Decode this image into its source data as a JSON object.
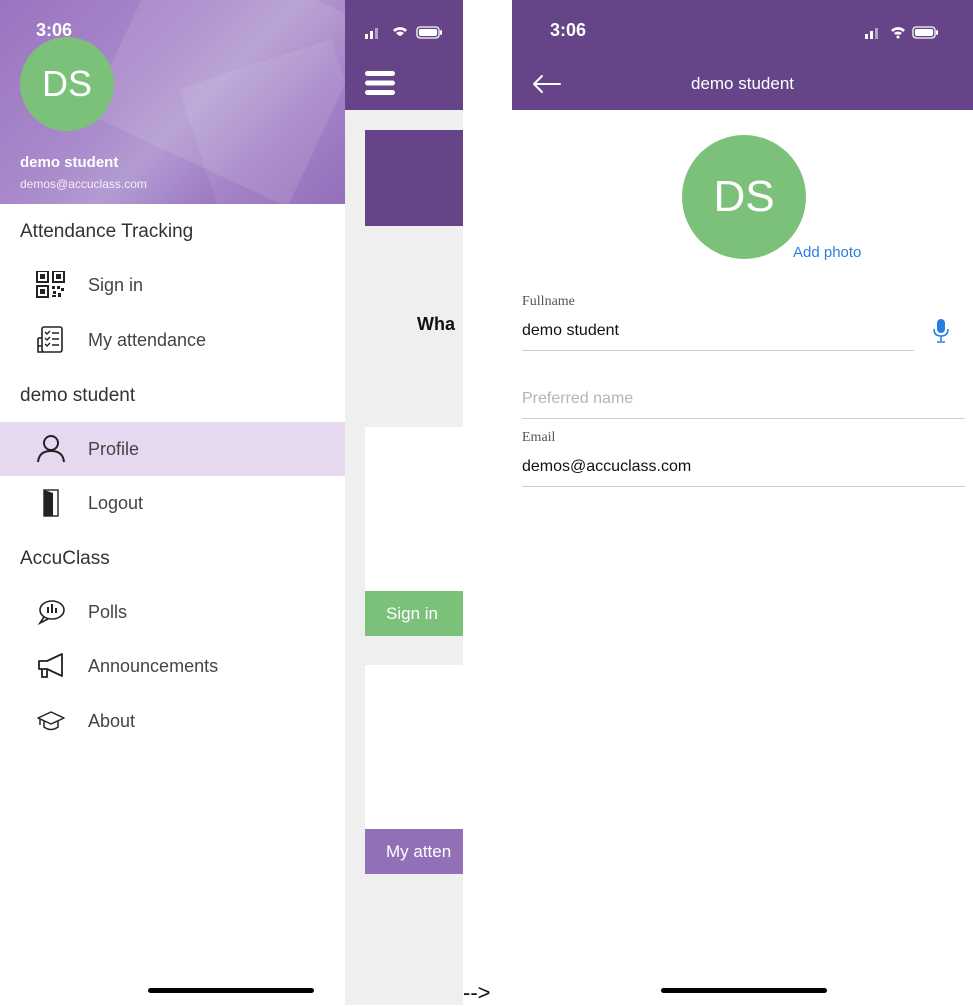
{
  "left": {
    "status_time": "3:06",
    "avatar_initials": "DS",
    "user_name": "demo student",
    "user_email": "demos@accuclass.com",
    "sections": [
      {
        "title": "Attendance Tracking",
        "items": [
          {
            "label": "Sign in",
            "icon": "qr-code-icon"
          },
          {
            "label": "My attendance",
            "icon": "checklist-icon"
          }
        ]
      },
      {
        "title": "demo student",
        "items": [
          {
            "label": "Profile",
            "icon": "person-icon",
            "active": true
          },
          {
            "label": "Logout",
            "icon": "door-icon"
          }
        ]
      },
      {
        "title": "AccuClass",
        "items": [
          {
            "label": "Polls",
            "icon": "poll-bubble-icon"
          },
          {
            "label": "Announcements",
            "icon": "megaphone-icon"
          },
          {
            "label": "About",
            "icon": "graduation-cap-icon"
          }
        ]
      }
    ],
    "background": {
      "partial_heading": "Wha",
      "sign_in_button": "Sign in",
      "my_attendance_button": "My atten",
      "colors": {
        "primary": "#654588",
        "green": "#7cc17a",
        "purple_button": "#9270b8"
      }
    }
  },
  "arrow_text": "-->",
  "right": {
    "status_time": "3:06",
    "title": "demo student",
    "avatar_initials": "DS",
    "add_photo": "Add photo",
    "fields": {
      "fullname_label": "Fullname",
      "fullname_value": "demo student",
      "preferred_placeholder": "Preferred name",
      "email_label": "Email",
      "email_value": "demos@accuclass.com"
    },
    "colors": {
      "header": "#654588",
      "avatar": "#7cc17a",
      "link": "#2a7de1"
    }
  }
}
